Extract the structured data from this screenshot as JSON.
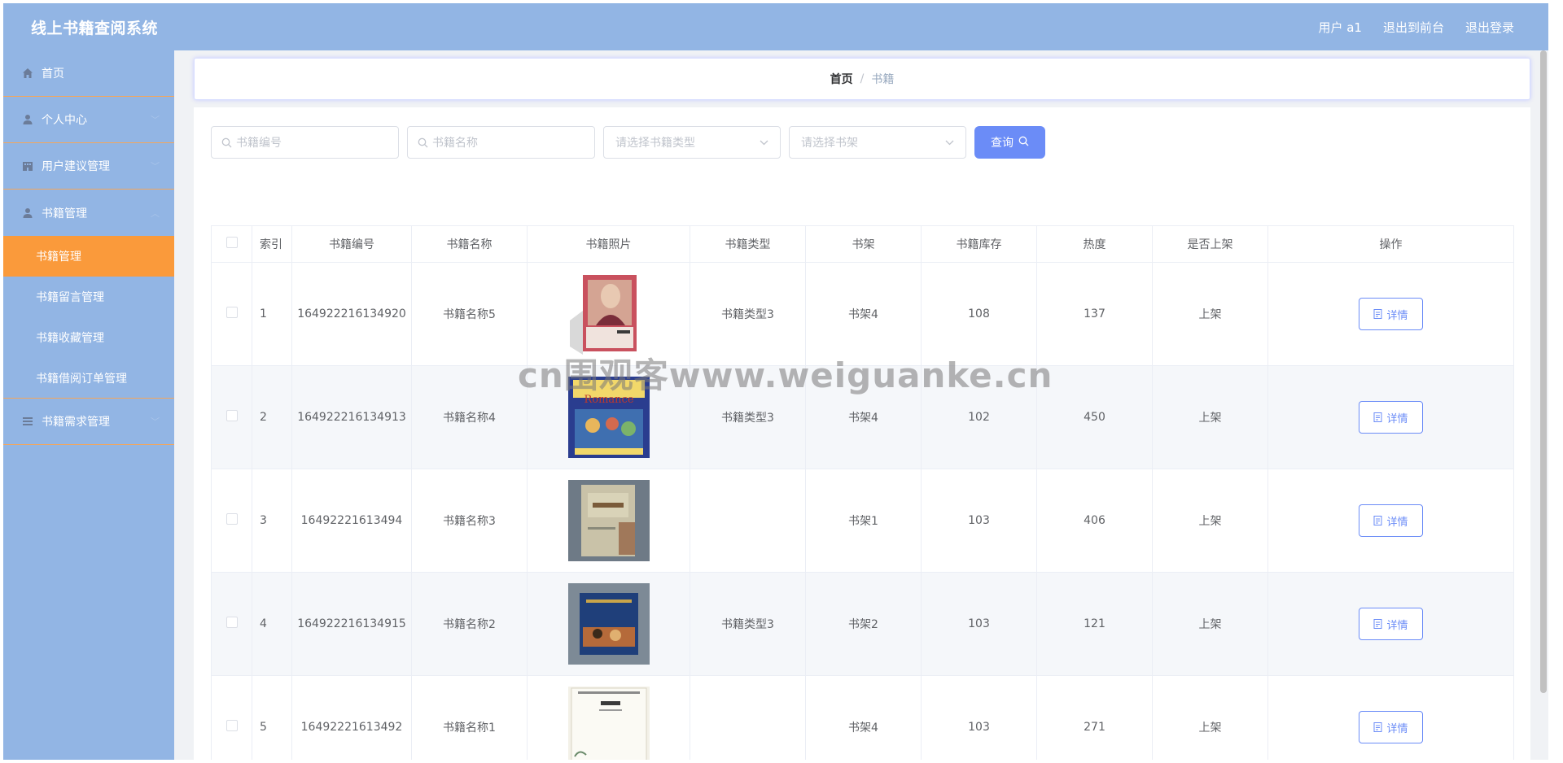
{
  "app": {
    "title": "线上书籍查阅系统"
  },
  "header": {
    "user": "用户 a1",
    "to_front": "退出到前台",
    "logout": "退出登录"
  },
  "sidebar": {
    "items": [
      {
        "label": "首页",
        "icon": "home-icon"
      },
      {
        "label": "个人中心",
        "icon": "user-icon"
      },
      {
        "label": "用户建议管理",
        "icon": "building-icon"
      },
      {
        "label": "书籍管理",
        "icon": "user-icon"
      },
      {
        "label": "书籍需求管理",
        "icon": "list-icon"
      }
    ],
    "sub_items": [
      {
        "label": "书籍管理",
        "active": true
      },
      {
        "label": "书籍留言管理"
      },
      {
        "label": "书籍收藏管理"
      },
      {
        "label": "书籍借阅订单管理"
      }
    ]
  },
  "breadcrumb": {
    "home": "首页",
    "separator": "/",
    "current": "书籍"
  },
  "filters": {
    "book_no_placeholder": "书籍编号",
    "book_name_placeholder": "书籍名称",
    "type_placeholder": "请选择书籍类型",
    "shelf_placeholder": "请选择书架",
    "query_label": "查询"
  },
  "table": {
    "columns": [
      "索引",
      "书籍编号",
      "书籍名称",
      "书籍照片",
      "书籍类型",
      "书架",
      "书籍库存",
      "热度",
      "是否上架",
      "操作"
    ],
    "rows": [
      {
        "idx": "1",
        "no": "164922216134920",
        "name": "书籍名称5",
        "type": "书籍类型3",
        "shelf": "书架4",
        "stock": "108",
        "heat": "137",
        "status": "上架",
        "action": "详情"
      },
      {
        "idx": "2",
        "no": "164922216134913",
        "name": "书籍名称4",
        "type": "书籍类型3",
        "shelf": "书架4",
        "stock": "102",
        "heat": "450",
        "status": "上架",
        "action": "详情"
      },
      {
        "idx": "3",
        "no": "16492221613494",
        "name": "书籍名称3",
        "type": "",
        "shelf": "书架1",
        "stock": "103",
        "heat": "406",
        "status": "上架",
        "action": "详情"
      },
      {
        "idx": "4",
        "no": "164922216134915",
        "name": "书籍名称2",
        "type": "书籍类型3",
        "shelf": "书架2",
        "stock": "103",
        "heat": "121",
        "status": "上架",
        "action": "详情"
      },
      {
        "idx": "5",
        "no": "16492221613492",
        "name": "书籍名称1",
        "type": "",
        "shelf": "书架4",
        "stock": "103",
        "heat": "271",
        "status": "上架",
        "action": "详情"
      }
    ],
    "cover_text_row2": "Romance"
  },
  "watermark": "cn围观客www.weiguanke.cn",
  "colors": {
    "header_bg": "#92b5e4",
    "sidebar_bg": "#92b5e4",
    "active_item": "#fa9a3b",
    "primary": "#6b8cf7"
  }
}
